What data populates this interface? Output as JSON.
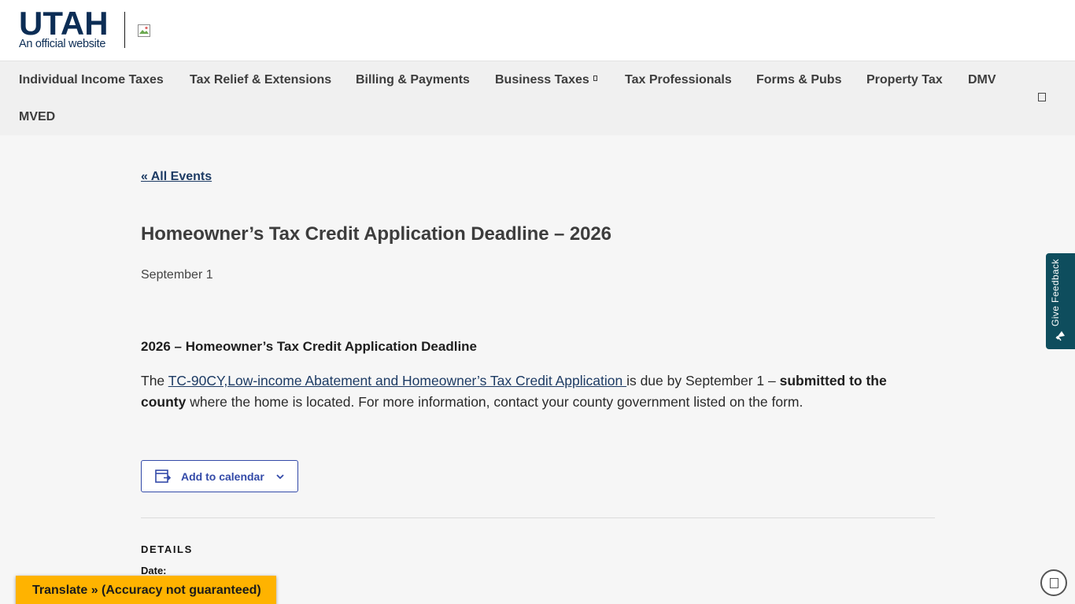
{
  "header": {
    "logo_title": "UTAH",
    "logo_subtitle": "An official website"
  },
  "nav": {
    "items": [
      {
        "label": "Individual Income Taxes"
      },
      {
        "label": "Tax Relief & Extensions"
      },
      {
        "label": "Billing & Payments"
      },
      {
        "label": "Business Taxes"
      },
      {
        "label": "Tax Professionals"
      },
      {
        "label": "Forms & Pubs"
      },
      {
        "label": "Property Tax"
      },
      {
        "label": "DMV"
      },
      {
        "label": "MVED"
      }
    ]
  },
  "event": {
    "back_link": "« All Events",
    "title": "Homeowner’s Tax Credit Application Deadline – 2026",
    "date": "September 1",
    "heading": "2026 – Homeowner’s Tax Credit Application Deadline",
    "desc_prefix": "The ",
    "desc_link": "TC-90CY,Low-income Abatement and Homeowner’s Tax Credit Application ",
    "desc_mid": "is due by September 1 – ",
    "desc_bold": "submitted to the county",
    "desc_suffix": " where the home is located. For more information, contact your county government listed on the form."
  },
  "calendar": {
    "label": "Add to calendar"
  },
  "details": {
    "heading": "DETAILS",
    "date_label": "Date:"
  },
  "feedback": {
    "label": "Give Feedback"
  },
  "translate": {
    "label": "Translate » (Accuracy not guaranteed)"
  },
  "colors": {
    "utah_navy": "#0c2d55",
    "link": "#1d3b64",
    "calendar_accent": "#334aa8",
    "feedback_bg": "#0e4d5d",
    "translate_bg": "#ffb300"
  }
}
